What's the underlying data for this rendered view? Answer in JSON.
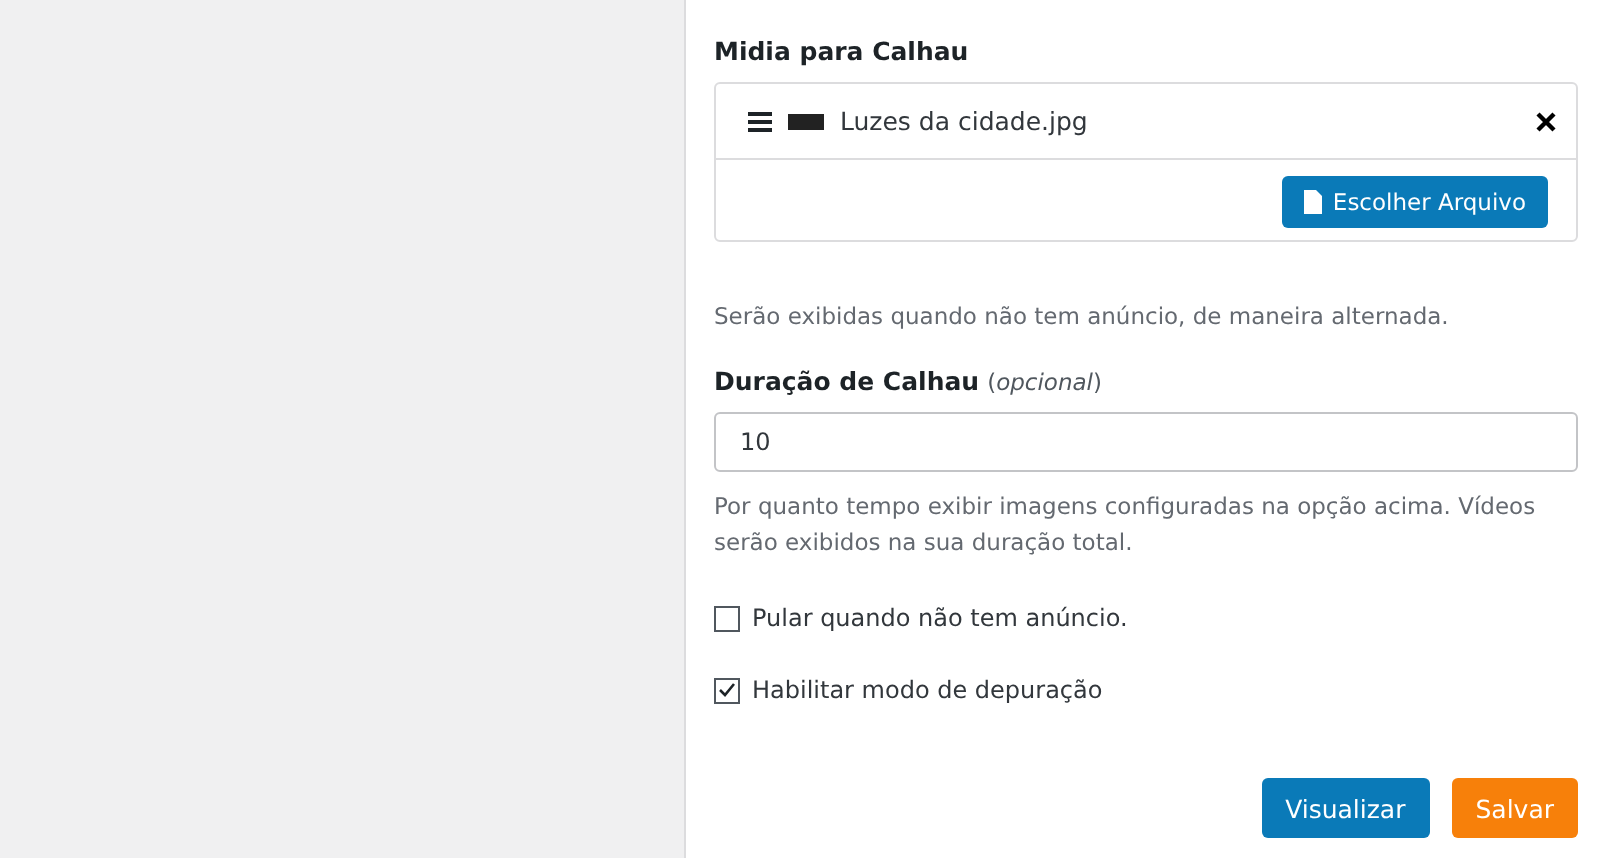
{
  "media": {
    "label": "Midia para Calhau",
    "files": [
      {
        "name": "Luzes da cidade.jpg"
      }
    ],
    "choose_button": "Escolher Arquivo"
  },
  "media_help": "Serão exibidas quando não tem anúncio, de maneira alternada.",
  "duration": {
    "label": "Duração de Calhau",
    "optional": "(*opcional*)",
    "value": "10",
    "help": "Por quanto tempo exibir imagens configuradas na opção acima. Vídeos serão exibidos na sua duração total."
  },
  "options": [
    {
      "label": "Pular quando não tem anúncio.",
      "checked": false
    },
    {
      "label": "Habilitar modo de depuração",
      "checked": true
    }
  ],
  "buttons": [
    {
      "label": "Visualizar",
      "kind": "secondary"
    },
    {
      "label": "Salvar",
      "kind": "primary"
    }
  ]
}
